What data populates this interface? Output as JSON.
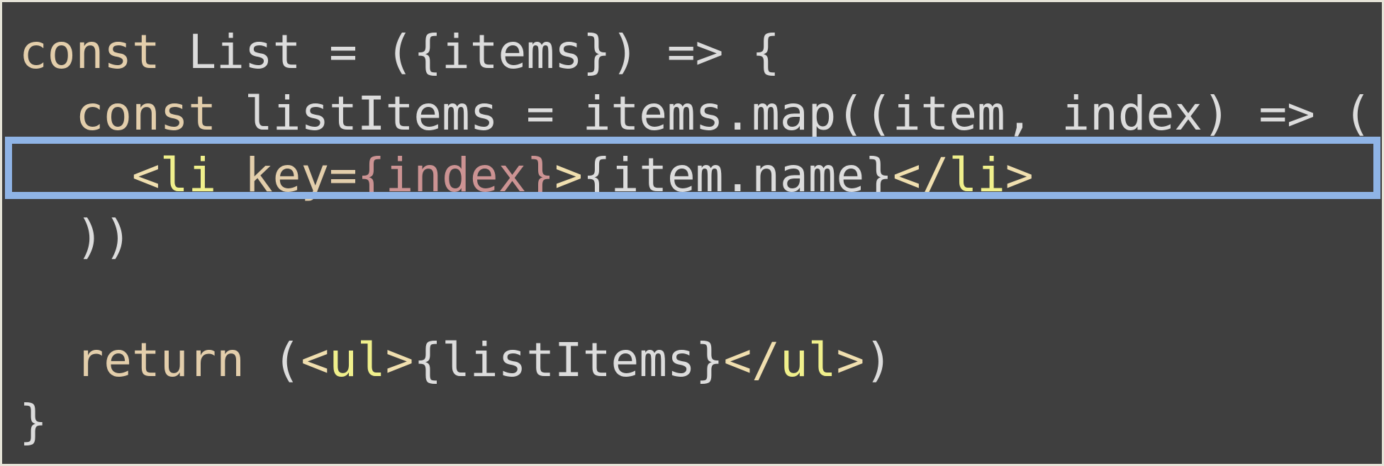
{
  "code": {
    "line1": {
      "kw": "const",
      "rest": " List = ({items}) => {"
    },
    "line2": {
      "indent": "  ",
      "kw": "const",
      "rest": " listItems = items.map((item, index) => ("
    },
    "line3": {
      "indent": "    ",
      "open_lt": "<",
      "tagname": "li",
      "space": " ",
      "attr": "key",
      "eq": "=",
      "brace_open": "{",
      "expr": "index",
      "brace_close": "}",
      "gt": ">",
      "content": "{item.name}",
      "close_lt": "</",
      "close_tagname": "li",
      "close_gt": ">"
    },
    "line4": {
      "indent": "  ",
      "text": "))"
    },
    "line5": {
      "text": ""
    },
    "line6": {
      "indent": "  ",
      "kw": "return",
      "paren_open": " (",
      "lt": "<",
      "tagname": "ul",
      "gt": ">",
      "content": "{listItems}",
      "close_lt": "</",
      "close_tagname": "ul",
      "close_gt": ">",
      "paren_close": ")"
    },
    "line7": {
      "text": "}"
    }
  },
  "colors": {
    "background": "#3f3f3f",
    "default_text": "#dcdcdc",
    "keyword": "#e3ceab",
    "tag_bracket": "#f0dfaf",
    "tag_name": "#f0f08c",
    "expression": "#cc9393",
    "highlight_border": "#8fb4e6"
  }
}
